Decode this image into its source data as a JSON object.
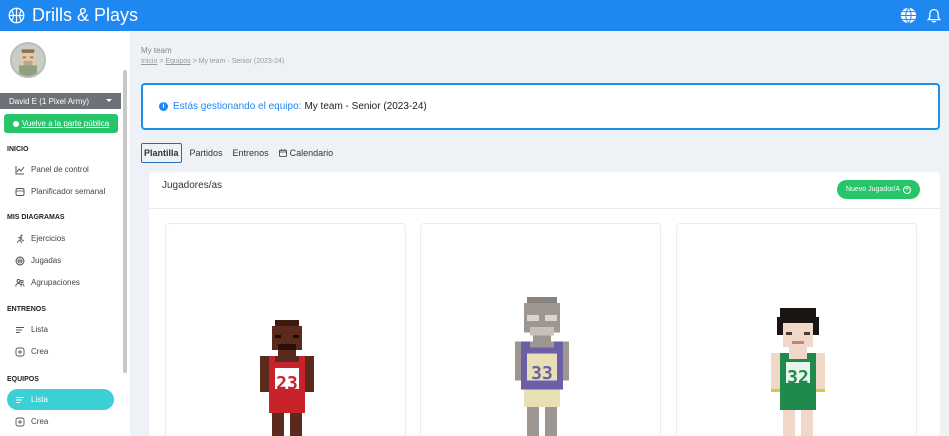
{
  "app": {
    "title": "Drills & Plays"
  },
  "sidebar": {
    "user_name": "David E (1 Pixel Army)",
    "public_link": "Vuelve a la parte pública",
    "sections": [
      {
        "title": "INICIO",
        "items": [
          "Panel de control",
          "Planificador semanal"
        ]
      },
      {
        "title": "MIS DIAGRAMAS",
        "items": [
          "Ejercicios",
          "Jugadas",
          "Agrupaciones"
        ]
      },
      {
        "title": "ENTRENOS",
        "items": [
          "Lista",
          "Crea"
        ]
      },
      {
        "title": "EQUIPOS",
        "items": [
          "Lista",
          "Crea"
        ]
      }
    ],
    "active_item": "EQUIPOS/Lista"
  },
  "header": {
    "page_title": "My team",
    "breadcrumb": [
      "Inicio",
      "Equipos",
      "My team - Senior (2023-24)"
    ]
  },
  "alert": {
    "lead": "Estás gestionando el equipo:",
    "team": "My team - Senior (2023-24)"
  },
  "tabs": [
    "Plantilla",
    "Partidos",
    "Entrenos",
    "Calendario"
  ],
  "active_tab": "Plantilla",
  "roster": {
    "title": "Jugadores/as",
    "new_button": "Nuevo Jugador/A",
    "players": [
      {
        "number": "23",
        "jersey_color": "#c8232b",
        "skin_color": "#5a2b1c"
      },
      {
        "number": "33",
        "jersey_color": "#6b5fa8",
        "skin_color": "#9e9690"
      },
      {
        "number": "32",
        "jersey_color": "#1f8a4c",
        "skin_color": "#f0d8c8"
      }
    ]
  },
  "colors": {
    "primary": "#1e88f0",
    "success": "#27c46a",
    "active": "#3ccfd6"
  }
}
